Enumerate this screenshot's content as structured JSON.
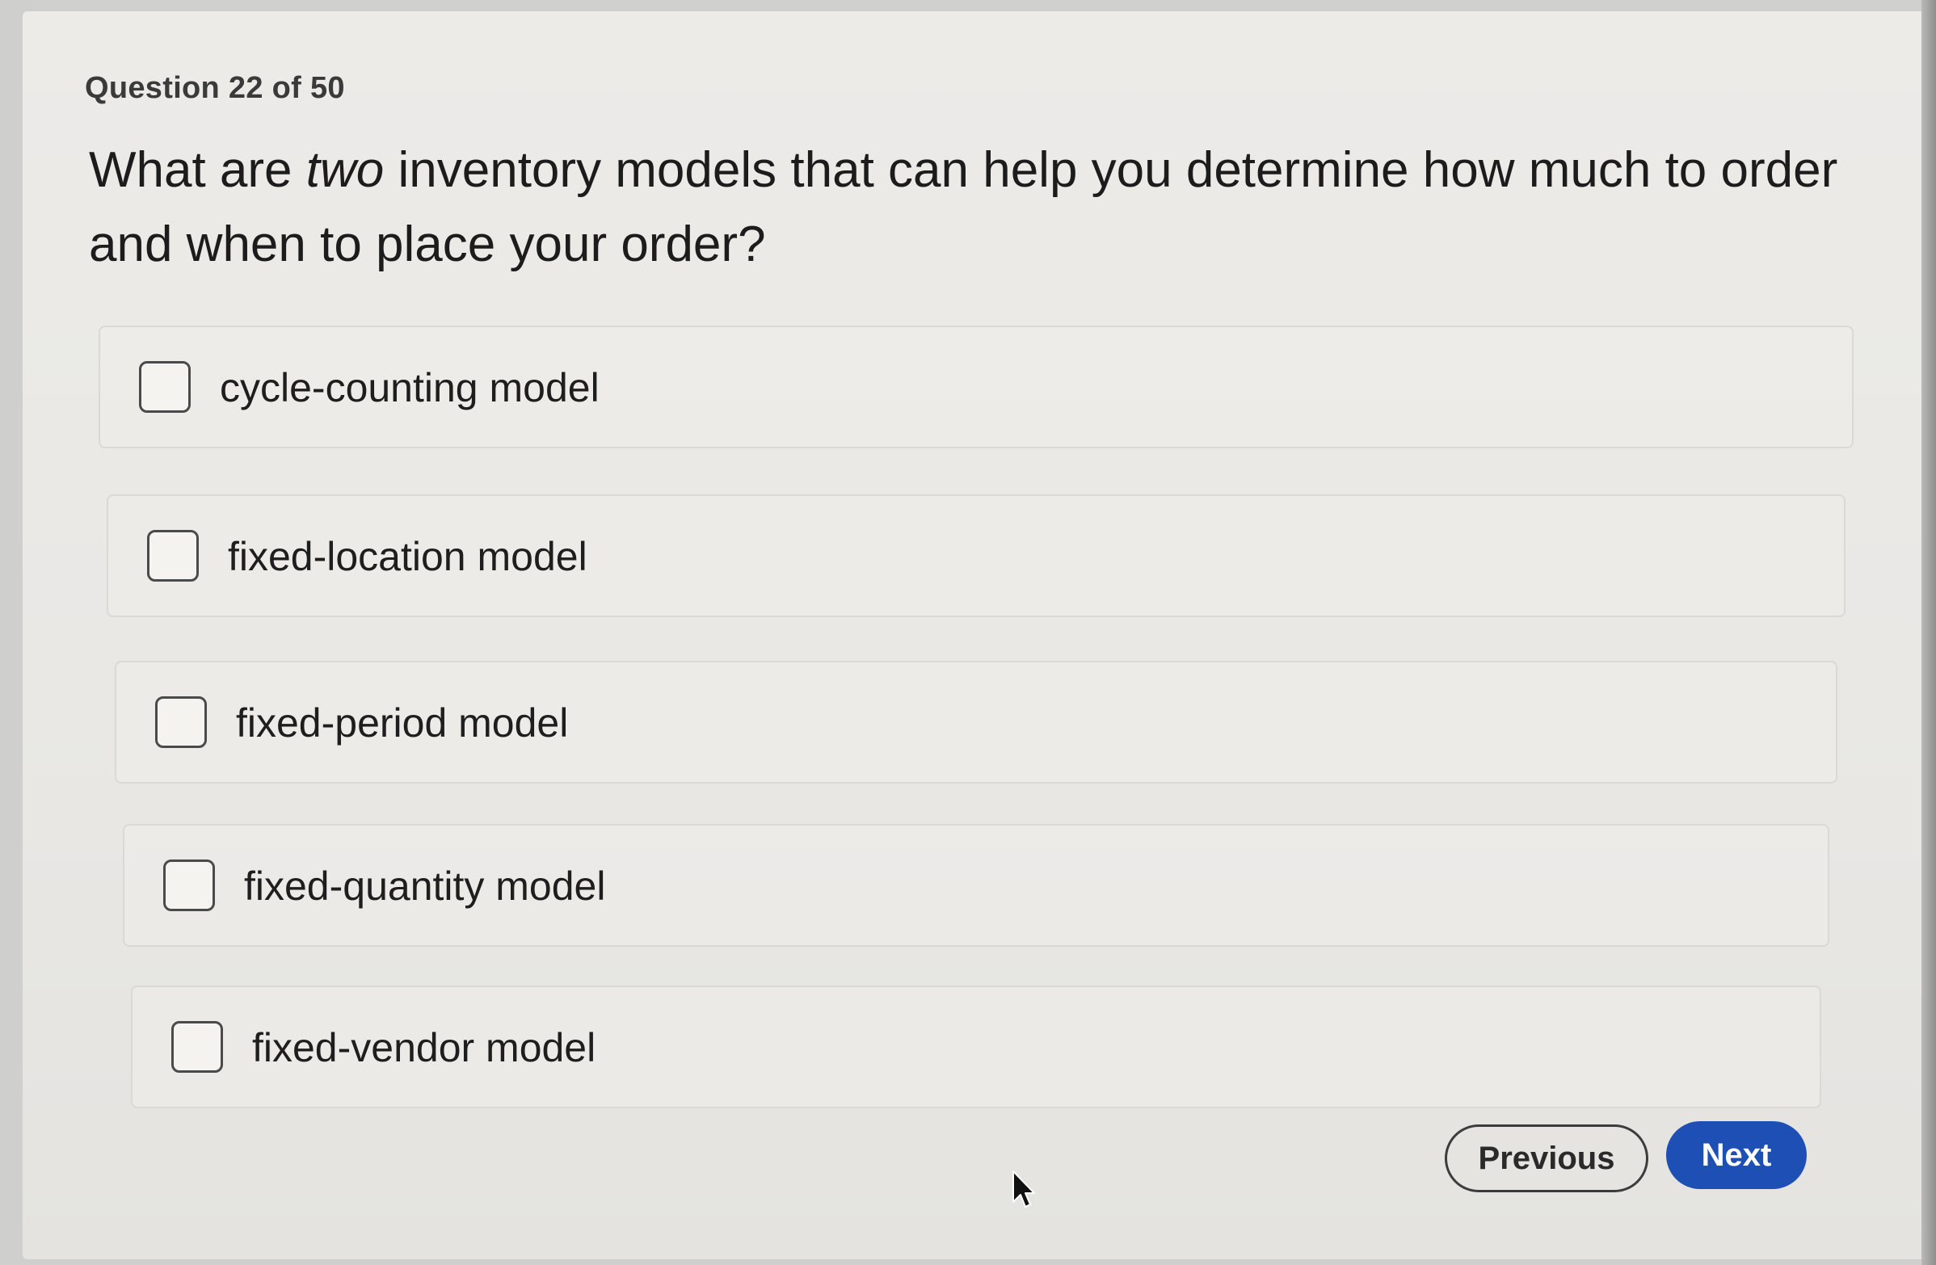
{
  "quiz": {
    "counter": "Question 22 of 50",
    "question_before": "What are ",
    "question_emphasis": "two",
    "question_after": " inventory models that can help you determine how much to order and when to place your order?",
    "options": [
      {
        "label": "cycle-counting model",
        "checked": false
      },
      {
        "label": "fixed-location model",
        "checked": false
      },
      {
        "label": "fixed-period model",
        "checked": false
      },
      {
        "label": "fixed-quantity model",
        "checked": false
      },
      {
        "label": "fixed-vendor model",
        "checked": false
      }
    ]
  },
  "nav": {
    "previous_label": "Previous",
    "next_label": "Next"
  },
  "colors": {
    "next_button": "#1d4fb5",
    "background": "#ecebe8"
  },
  "icons": {
    "checkbox": "empty-square",
    "pointer": "mouse-pointer-icon"
  }
}
